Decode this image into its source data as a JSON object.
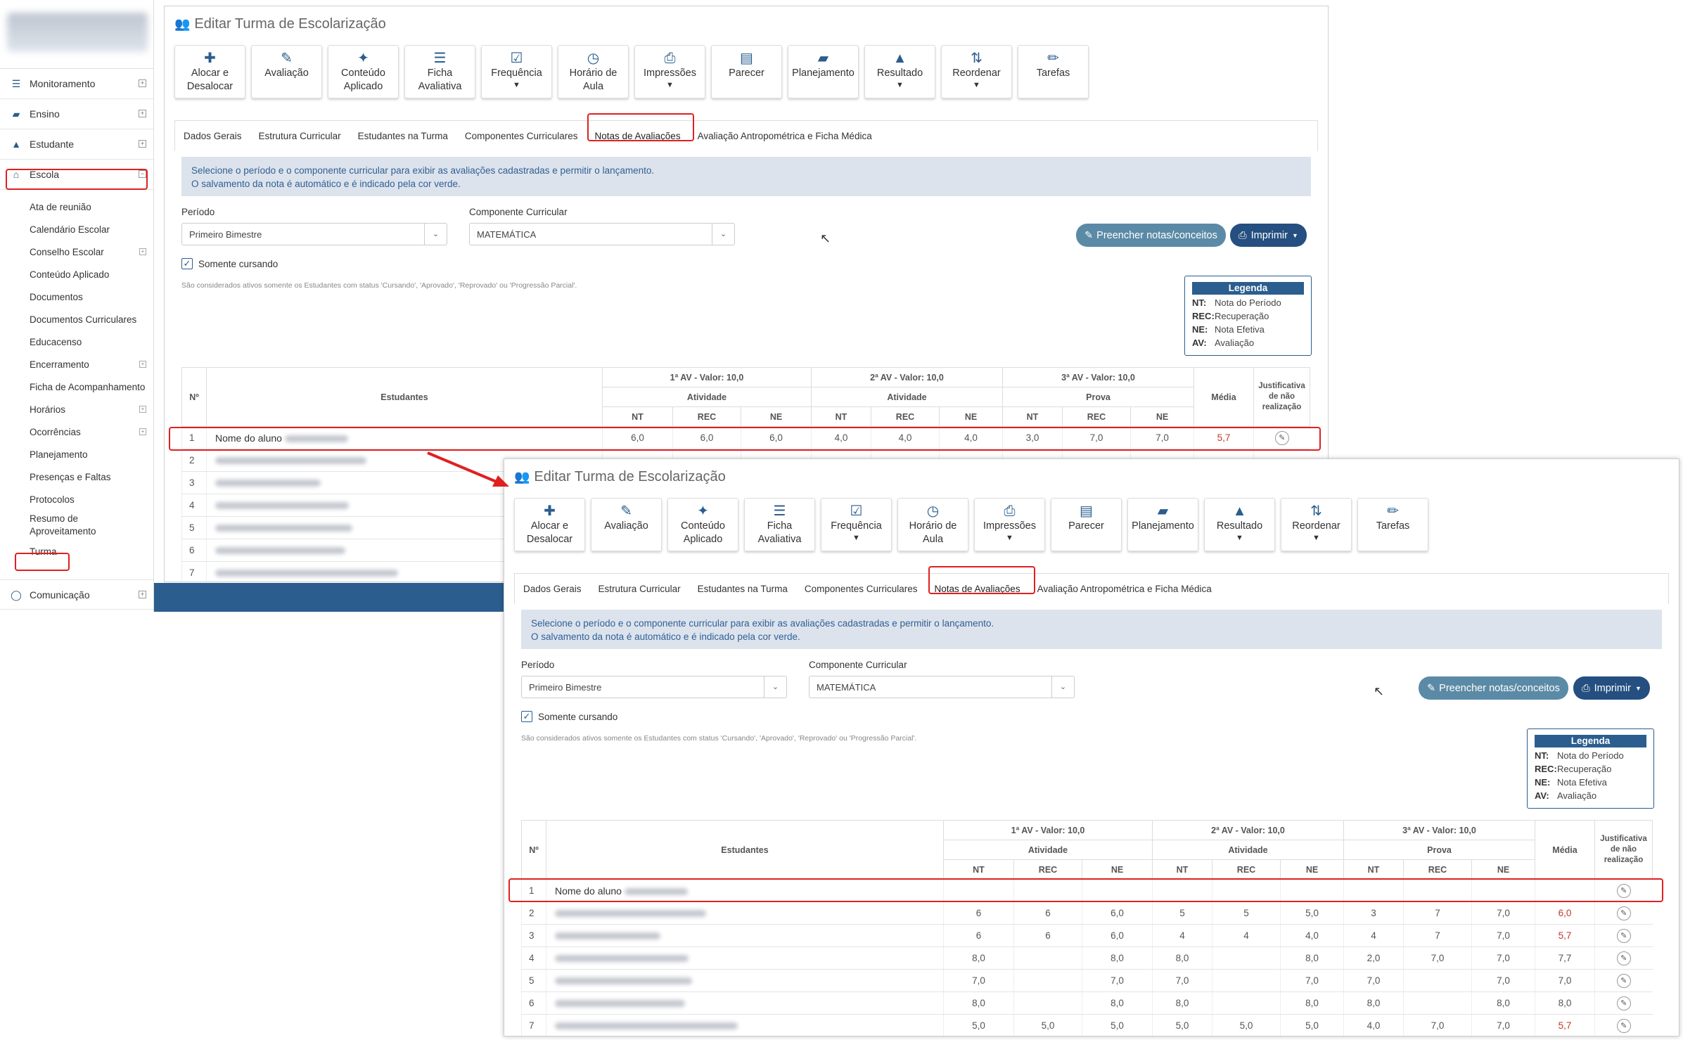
{
  "sidebar": {
    "items": [
      {
        "label": "Monitoramento",
        "icon": "sliders-icon"
      },
      {
        "label": "Ensino",
        "icon": "book-icon"
      },
      {
        "label": "Estudante",
        "icon": "graduation-cap-icon"
      },
      {
        "label": "Escola",
        "icon": "bank-icon"
      }
    ],
    "sub_items": [
      "Ata de reunião",
      "Calendário Escolar",
      "Conselho Escolar",
      "Conteúdo Aplicado",
      "Documentos",
      "Documentos Curriculares",
      "Educacenso",
      "Encerramento",
      "Ficha de Acompanhamento",
      "Horários",
      "Ocorrências",
      "Planejamento",
      "Presenças e Faltas",
      "Protocolos",
      "Resumo de Aproveitamento",
      "Turma"
    ],
    "footer_item": {
      "label": "Comunicação",
      "icon": "chat-icon"
    }
  },
  "page": {
    "title": "Editar Turma de Escolarização",
    "toolbar": [
      {
        "label": "Alocar e Desalocar",
        "icon": "puzzle-icon"
      },
      {
        "label": "Avaliação",
        "icon": "edit-icon"
      },
      {
        "label": "Conteúdo Aplicado",
        "icon": "wand-icon"
      },
      {
        "label": "Ficha Avaliativa",
        "icon": "list-icon"
      },
      {
        "label": "Frequência",
        "icon": "checkbox-icon"
      },
      {
        "label": "Horário de Aula",
        "icon": "clock-icon"
      },
      {
        "label": "Impressões",
        "icon": "printer-icon"
      },
      {
        "label": "Parecer",
        "icon": "document-icon"
      },
      {
        "label": "Planejamento",
        "icon": "book-icon"
      },
      {
        "label": "Resultado",
        "icon": "graduation-cap-icon"
      },
      {
        "label": "Reordenar",
        "icon": "sort-az-icon"
      },
      {
        "label": "Tarefas",
        "icon": "pencil-icon"
      }
    ],
    "tabs": [
      "Dados Gerais",
      "Estrutura Curricular",
      "Estudantes na Turma",
      "Componentes Curriculares",
      "Notas de Avaliações",
      "Avaliação Antropométrica e Ficha Médica"
    ],
    "info_line1": "Selecione o período e o componente curricular para exibir as avaliações cadastradas e permitir o lançamento.",
    "info_line2": "O salvamento da nota é automático e é indicado pela cor verde.",
    "periodo_label": "Período",
    "periodo_value": "Primeiro Bimestre",
    "componente_label": "Componente Curricular",
    "componente_value": "MATEMÁTICA",
    "fill_button": "Preencher notas/conceitos",
    "print_button": "Imprimir",
    "somente_cursando": "Somente cursando",
    "note": "São considerados ativos somente os Estudantes com status 'Cursando', 'Aprovado', 'Reprovado' ou 'Progressão Parcial'.",
    "legend": {
      "title": "Legenda",
      "rows": [
        {
          "key": "NT:",
          "value": "Nota do Período"
        },
        {
          "key": "REC:",
          "value": "Recuperação"
        },
        {
          "key": "NE:",
          "value": "Nota Efetiva"
        },
        {
          "key": "AV:",
          "value": "Avaliação"
        }
      ]
    },
    "table": {
      "h_num": "Nº",
      "h_students": "Estudantes",
      "h_av1": "1ª AV - Valor: 10,0",
      "h_av2": "2ª AV - Valor: 10,0",
      "h_av3": "3ª AV - Valor: 10,0",
      "h_type1": "Atividade",
      "h_type2": "Atividade",
      "h_type3": "Prova",
      "h_media": "Média",
      "h_just": "Justificativa de não realização",
      "h_nt": "NT",
      "h_rec": "REC",
      "h_ne": "NE"
    }
  },
  "before_rows": [
    {
      "n": "1",
      "name": "Nome do aluno",
      "v": [
        "6,0",
        "6,0",
        "6,0",
        "4,0",
        "4,0",
        "4,0",
        "3,0",
        "7,0",
        "7,0"
      ],
      "media": "5,7",
      "media_red": true
    },
    {
      "n": "2"
    },
    {
      "n": "3"
    },
    {
      "n": "4"
    },
    {
      "n": "5"
    },
    {
      "n": "6"
    },
    {
      "n": "7"
    }
  ],
  "after_rows": [
    {
      "n": "1",
      "name": "Nome do aluno",
      "v": [
        "",
        "",
        "",
        "",
        "",
        "",
        "",
        "",
        ""
      ],
      "media": "",
      "media_red": false
    },
    {
      "n": "2",
      "name": "",
      "v": [
        "6",
        "6",
        "6,0",
        "5",
        "5",
        "5,0",
        "3",
        "7",
        "7,0"
      ],
      "media": "6,0",
      "media_red": true
    },
    {
      "n": "3",
      "name": "",
      "v": [
        "6",
        "6",
        "6,0",
        "4",
        "4",
        "4,0",
        "4",
        "7",
        "7,0"
      ],
      "media": "5,7",
      "media_red": true
    },
    {
      "n": "4",
      "name": "",
      "v": [
        "8,0",
        "",
        "8,0",
        "8,0",
        "",
        "8,0",
        "2,0",
        "7,0",
        "7,0"
      ],
      "media": "7,7",
      "media_red": false
    },
    {
      "n": "5",
      "name": "",
      "v": [
        "7,0",
        "",
        "7,0",
        "7,0",
        "",
        "7,0",
        "7,0",
        "",
        "7,0"
      ],
      "media": "7,0",
      "media_red": false
    },
    {
      "n": "6",
      "name": "",
      "v": [
        "8,0",
        "",
        "8,0",
        "8,0",
        "",
        "8,0",
        "8,0",
        "",
        "8,0"
      ],
      "media": "8,0",
      "media_red": false
    },
    {
      "n": "7",
      "name": "",
      "v": [
        "5,0",
        "5,0",
        "5,0",
        "5,0",
        "5,0",
        "5,0",
        "4,0",
        "7,0",
        "7,0"
      ],
      "media": "5,7",
      "media_red": true
    }
  ]
}
